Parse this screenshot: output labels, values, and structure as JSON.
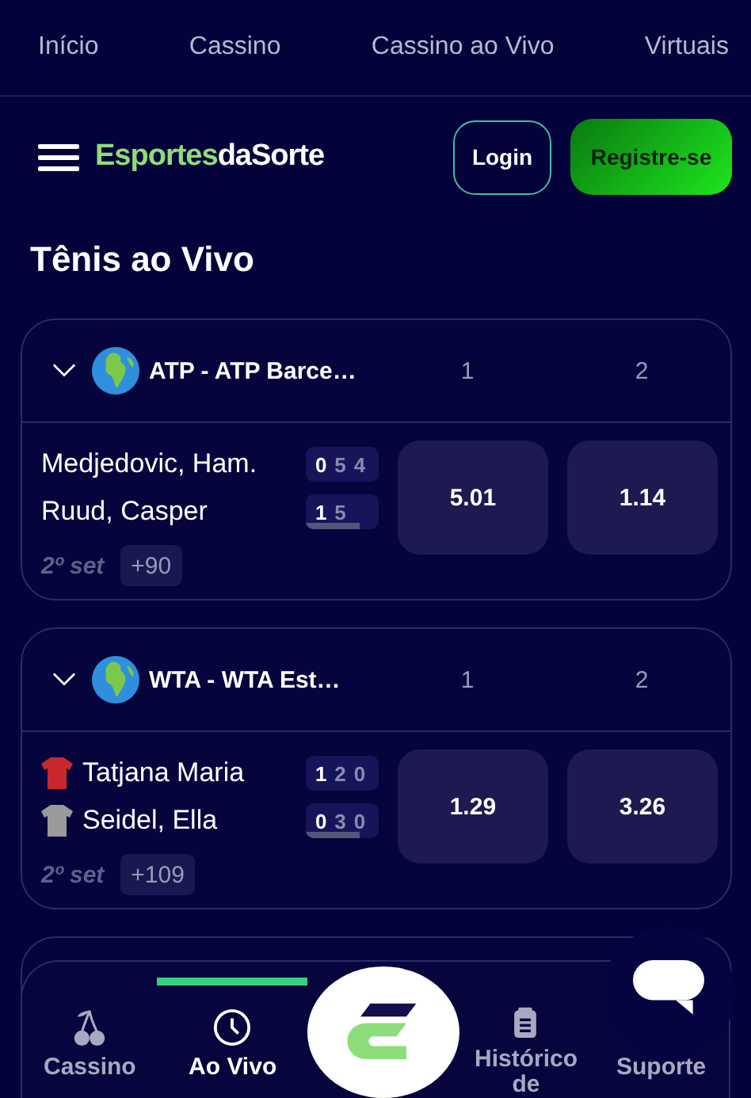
{
  "top_nav": [
    {
      "label": "Início",
      "selected": false
    },
    {
      "label": "Cassino",
      "selected": false
    },
    {
      "label": "Cassino ao Vivo",
      "selected": false
    },
    {
      "label": "Virtuais",
      "selected": false
    }
  ],
  "header": {
    "logo_part_1": "Esportes",
    "logo_part_2": "da",
    "logo_part_3": "Sorte",
    "login": "Login",
    "register": "Registre-se"
  },
  "title": "Tênis ao Vivo",
  "leagues": [
    {
      "name": "ATP - ATP Barce…",
      "expanded": true,
      "col_1": "1",
      "col_2": "2",
      "matches": [
        {
          "players": [
            {
              "name": "Medjedovic, Ham.",
              "scores": [
                "0",
                "5",
                "4"
              ]
            },
            {
              "name": "Ruud, Casper",
              "scores": [
                "1",
                "5"
              ]
            }
          ],
          "period": "2º set",
          "more": "+90",
          "odds": [
            "5.01",
            "1.14"
          ]
        }
      ]
    },
    {
      "name": "WTA - WTA Est…",
      "expanded": true,
      "col_1": "1",
      "col_2": "2",
      "matches": [
        {
          "players": [
            {
              "name": "Tatjana Maria",
              "scores": [
                "1",
                "2",
                "0"
              ],
              "color": "#c8282a"
            },
            {
              "name": "Seidel, Ella",
              "scores": [
                "0",
                "3",
                "0"
              ],
              "color": "#9a9a9a"
            }
          ],
          "period": "2º set",
          "more": "+109",
          "odds": [
            "1.29",
            "3.26"
          ]
        }
      ]
    }
  ],
  "bottom_nav": [
    {
      "label": "Cassino",
      "kind": "casino",
      "selected": false
    },
    {
      "label": "Ao Vivo",
      "kind": "live",
      "selected": true
    },
    {
      "label": "Histórico de",
      "kind": "history",
      "selected": false
    },
    {
      "label": "Suporte",
      "kind": "support",
      "selected": false
    }
  ]
}
